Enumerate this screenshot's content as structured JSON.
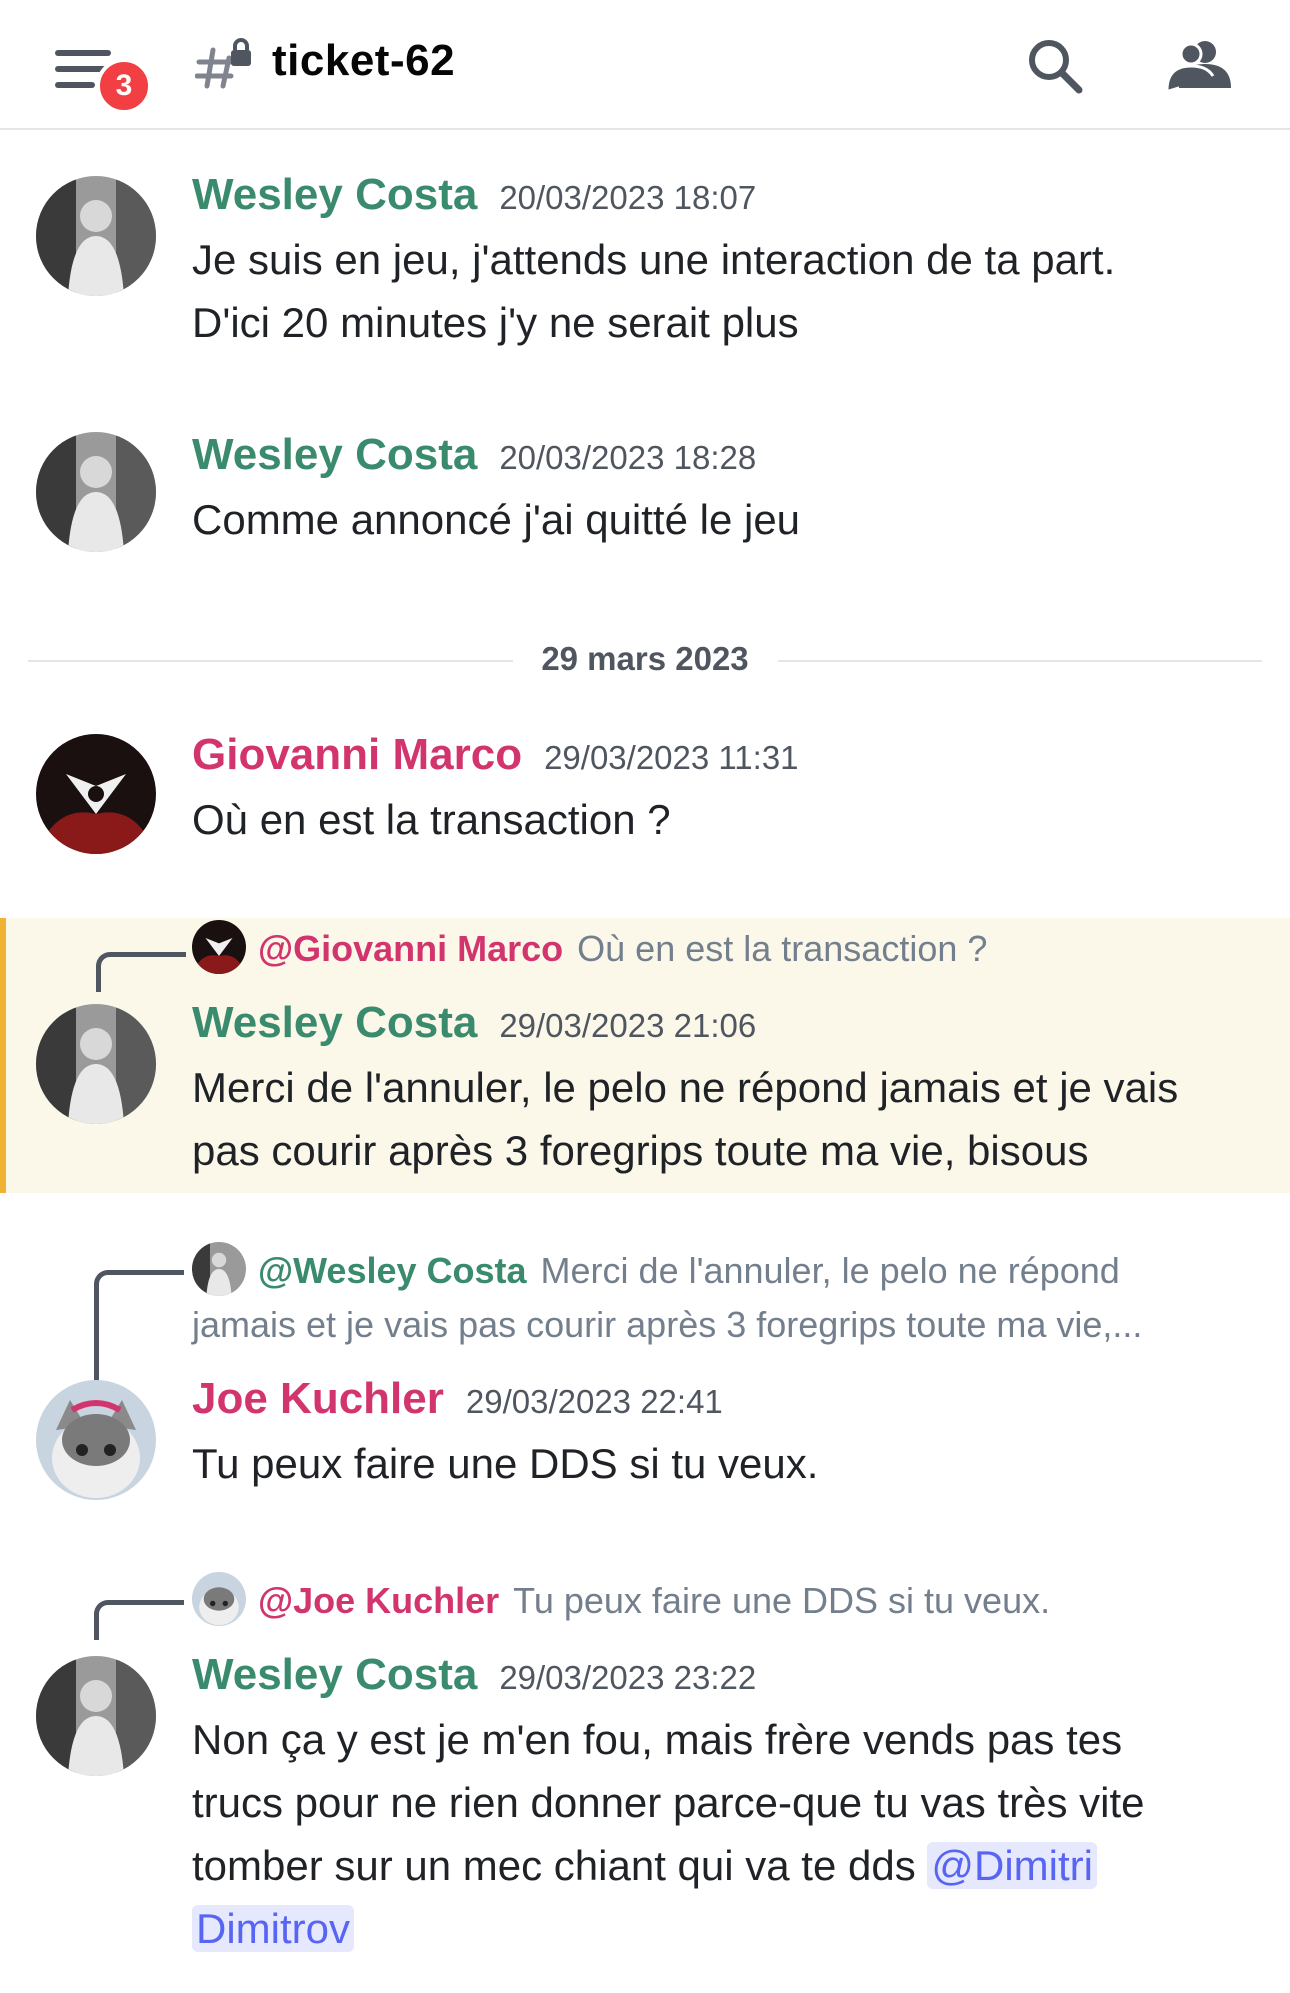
{
  "header": {
    "channel_name": "ticket-62",
    "unread_badge": "3"
  },
  "divider": {
    "label": "29 mars 2023"
  },
  "messages": [
    {
      "author": "Wesley Costa",
      "time": "20/03/2023 18:07",
      "text1": "Je suis en jeu, j'attends une interaction de ta part.",
      "text2": "D'ici 20 minutes j'y ne serait plus"
    },
    {
      "author": "Wesley Costa",
      "time": "20/03/2023 18:28",
      "text1": "Comme annoncé j'ai quitté le jeu"
    },
    {
      "author": "Giovanni Marco",
      "time": "29/03/2023 11:31",
      "text1": "Où en est la transaction ?"
    },
    {
      "reply_name": "@Giovanni Marco",
      "reply_text": "Où en est la transaction ?",
      "author": "Wesley Costa",
      "time": "29/03/2023 21:06",
      "text1": "Merci de l'annuler, le pelo ne répond jamais et je vais",
      "text2": "pas courir après 3 foregrips toute ma vie, bisous"
    },
    {
      "reply_name": "@Wesley Costa",
      "reply_text": "Merci de l'annuler, le pelo ne répond",
      "reply_text2": "jamais et je vais pas courir après 3 foregrips toute ma vie,...",
      "author": "Joe Kuchler",
      "time": "29/03/2023 22:41",
      "text1": "Tu peux faire une DDS si tu veux."
    },
    {
      "reply_name": "@Joe Kuchler",
      "reply_text": "Tu peux faire une DDS si tu veux.",
      "author": "Wesley Costa",
      "time": "29/03/2023 23:22",
      "text1": "Non ça y est je m'en fou, mais frère vends pas tes",
      "text2": "trucs pour ne rien donner parce-que tu vas très vite",
      "text3": "tomber sur un mec chiant qui va te dds ",
      "mention1": "@Dimitri",
      "mention2": "Dimitrov"
    }
  ],
  "colors": {
    "green_author": "#3a8b6d",
    "pink_author": "#d2356d",
    "highlight_bg": "#fbf8ea",
    "highlight_bar": "#f0b232",
    "mention_fg": "#5865f2",
    "badge": "#f23f43"
  }
}
